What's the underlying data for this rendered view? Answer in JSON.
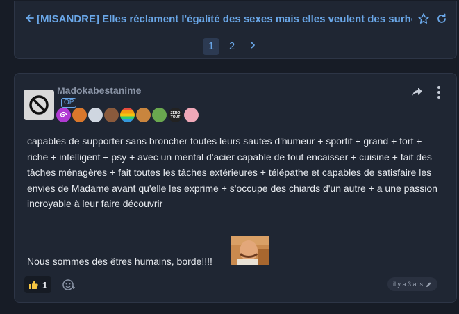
{
  "topic": {
    "title": "[MISANDRE] Elles réclament l'égalité des sexes mais elles veulent des surhom",
    "pages": [
      "1",
      "2"
    ],
    "current_page": "1",
    "accent_color": "#6aa7e8"
  },
  "post": {
    "author": "Madokabestanime",
    "op_label": "OP",
    "badges": [
      {
        "icon": "spiral-icon"
      },
      {
        "icon": "character-icon"
      },
      {
        "icon": "character-icon"
      },
      {
        "icon": "character-icon"
      },
      {
        "icon": "rainbow-icon"
      },
      {
        "icon": "character-icon"
      },
      {
        "icon": "character-icon"
      },
      {
        "icon": "zero-tout-icon",
        "text": "ZÉRO TOUT"
      },
      {
        "icon": "character-icon"
      }
    ],
    "body": "capables de supporter sans broncher toutes leurs sautes d'humeur + sportif + grand + fort + riche + intelligent + psy + avec un mental d'acier capable de tout encaisser + cuisine + fait des tâches ménagères + fait toutes les tâches extérieures + télépathe et capables de satisfaire les envies de Madame avant qu'elle les exprime + s'occupe des chiards d'un autre + a une passion incroyable à leur faire découvrir",
    "signoff": "Nous sommes des êtres humains, borde!!!!",
    "like_count": "1",
    "timestamp": "il y a 3 ans"
  }
}
